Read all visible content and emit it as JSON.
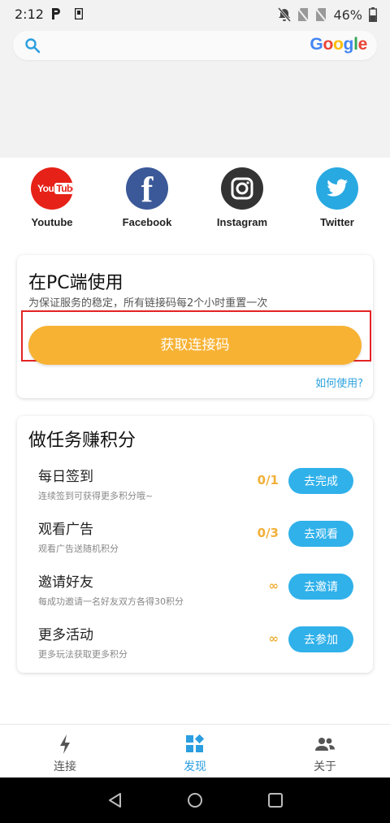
{
  "status_bar": {
    "time": "2:12",
    "battery_percent": "46%",
    "icons": [
      "parking-icon",
      "document-icon",
      "mute-bell-icon",
      "no-sim-icon",
      "no-sim-icon",
      "battery-icon"
    ]
  },
  "search": {
    "logo_letters": [
      "G",
      "o",
      "o",
      "g",
      "l",
      "e"
    ],
    "logo_colors": [
      "#4285f4",
      "#ea4335",
      "#fbbc05",
      "#4285f4",
      "#34a853",
      "#ea4335"
    ]
  },
  "social": [
    {
      "label": "Youtube",
      "icon": "youtube-icon",
      "logo_text_a": "You",
      "logo_text_b": "Tube",
      "color": "#e62117"
    },
    {
      "label": "Facebook",
      "icon": "facebook-icon",
      "logo_text": "f",
      "color": "#3b5998"
    },
    {
      "label": "Instagram",
      "icon": "instagram-icon",
      "color": "#333333"
    },
    {
      "label": "Twitter",
      "icon": "twitter-icon",
      "color": "#29a9e1"
    }
  ],
  "pc_card": {
    "title": "在PC端使用",
    "subtitle": "为保证服务的稳定，所有链接码每2个小时重置一次",
    "button": "获取连接码",
    "help_link": "如何使用?"
  },
  "tasks_card": {
    "title": "做任务赚积分",
    "tasks": [
      {
        "name": "每日签到",
        "desc": "连续签到可获得更多积分哦~",
        "count": "0/1",
        "button": "去完成"
      },
      {
        "name": "观看广告",
        "desc": "观看广告送随机积分",
        "count": "0/3",
        "button": "去观看"
      },
      {
        "name": "邀请好友",
        "desc": "每成功邀请一名好友双方各得30积分",
        "count": "∞",
        "button": "去邀请"
      },
      {
        "name": "更多活动",
        "desc": "更多玩法获取更多积分",
        "count": "∞",
        "button": "去参加"
      }
    ]
  },
  "bottom_nav": {
    "items": [
      {
        "label": "连接",
        "icon": "lightning-icon",
        "active": false
      },
      {
        "label": "发现",
        "icon": "discover-icon",
        "active": true
      },
      {
        "label": "关于",
        "icon": "people-icon",
        "active": false
      }
    ]
  },
  "colors": {
    "accent_orange": "#f7b234",
    "accent_blue": "#30b1ea",
    "nav_active": "#2b9ee0",
    "highlight_red": "#e32424"
  }
}
